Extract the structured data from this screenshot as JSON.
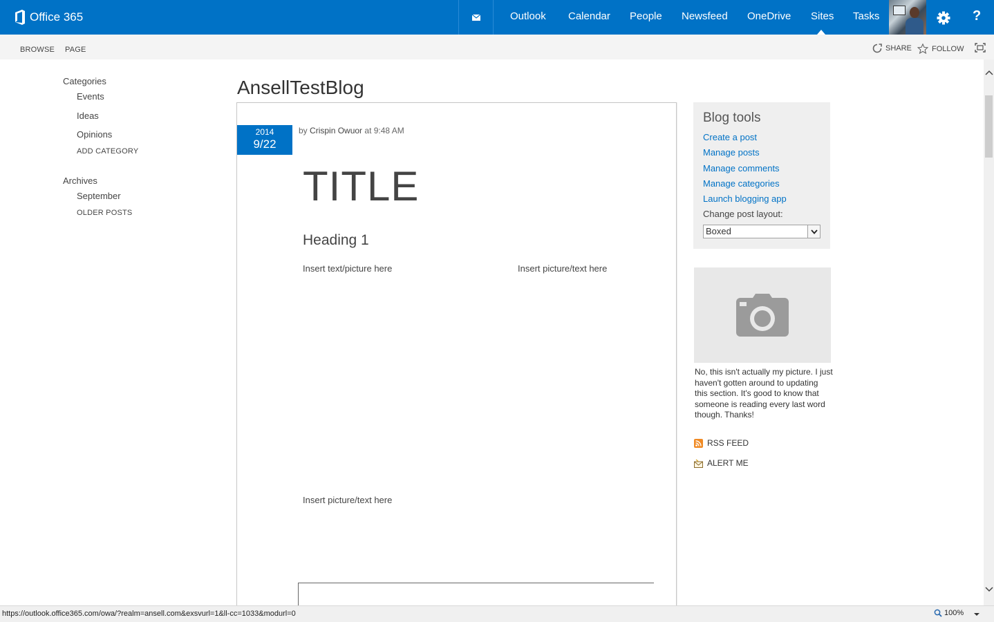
{
  "suitebar": {
    "brand": "Office 365",
    "nav": [
      "Outlook",
      "Calendar",
      "People",
      "Newsfeed",
      "OneDrive",
      "Sites",
      "Tasks"
    ],
    "active": "Sites",
    "help": "?"
  },
  "ribbon": {
    "tabs": [
      "BROWSE",
      "PAGE"
    ],
    "share": "SHARE",
    "follow": "FOLLOW"
  },
  "quicklaunch": {
    "categories_heading": "Categories",
    "categories": [
      "Events",
      "Ideas",
      "Opinions"
    ],
    "add_category": "ADD CATEGORY",
    "archives_heading": "Archives",
    "archives": [
      "September"
    ],
    "older_posts": "OLDER POSTS"
  },
  "site": {
    "title": "AnsellTestBlog"
  },
  "post": {
    "year": "2014",
    "date": "9/22",
    "by": "by",
    "author": "Crispin Owuor",
    "at": "at 9:48 AM",
    "title": "TITLE",
    "heading": "Heading 1",
    "text_left": "Insert text/picture here",
    "text_right": "Insert picture/text here",
    "text_bottom": "Insert picture/text here"
  },
  "blog_tools": {
    "title": "Blog tools",
    "links": [
      "Create a post",
      "Manage posts",
      "Manage comments",
      "Manage categories",
      "Launch blogging app"
    ],
    "layout_label": "Change post layout:",
    "layout_value": "Boxed"
  },
  "about": {
    "text": "No, this isn't actually my picture. I just haven't gotten around to updating this section. It's good to know that someone is reading every last word though. Thanks!"
  },
  "side_links": {
    "rss": "RSS FEED",
    "alert": "ALERT ME"
  },
  "statusbar": {
    "url": "https://outlook.office365.com/owa/?realm=ansell.com&exsvurl=1&ll-cc=1033&modurl=0",
    "zoom": "100%"
  },
  "colors": {
    "brand_blue": "#0072c6",
    "link_blue": "#0072c6",
    "rss_orange": "#f08a24"
  }
}
